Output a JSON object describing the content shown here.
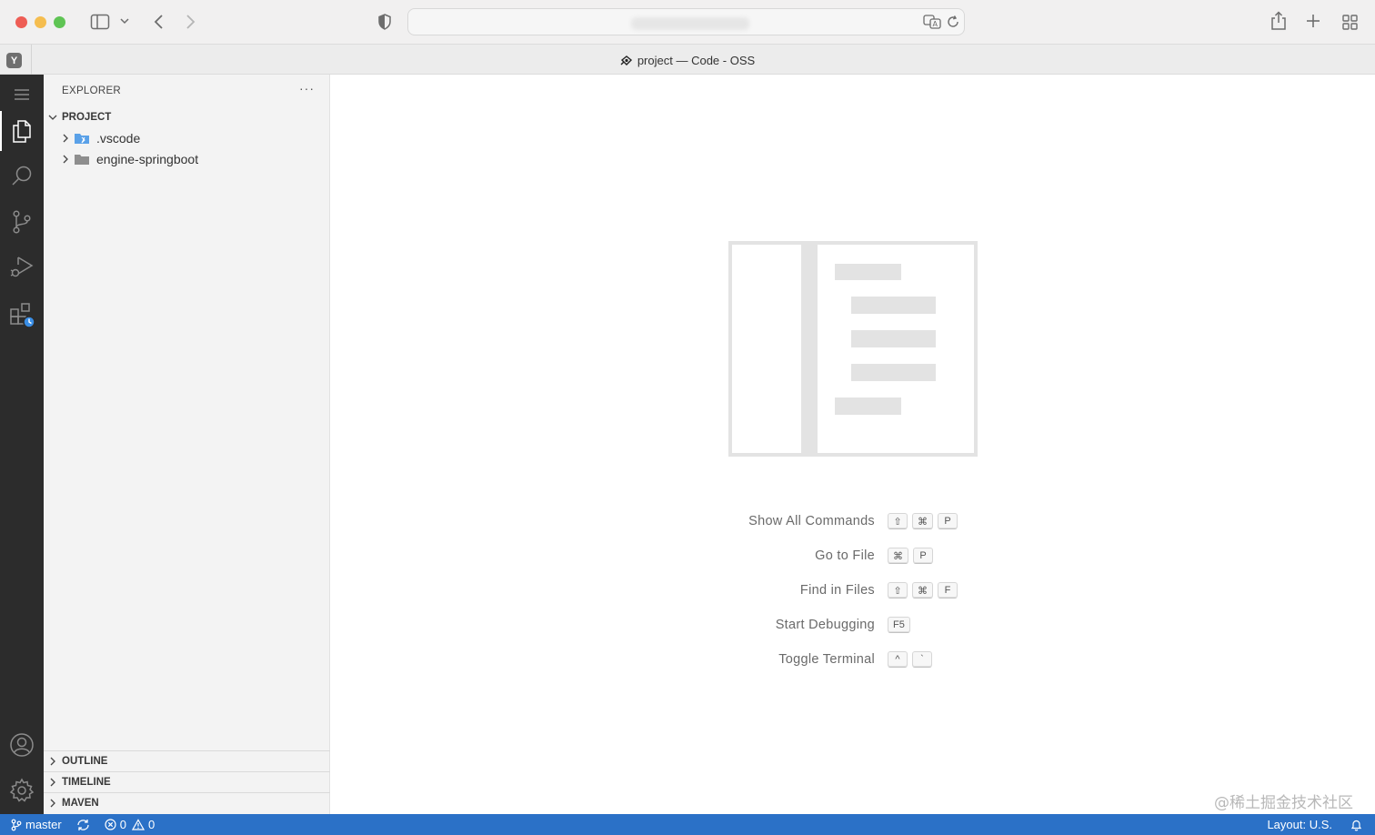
{
  "window": {
    "title": "project — Code - OSS",
    "tab_favicon": "Y"
  },
  "browser": {
    "icons": [
      "sidebar-toggle-icon",
      "chevron-down-icon",
      "back-icon",
      "forward-icon",
      "shield-icon",
      "translate-icon",
      "reload-icon",
      "share-icon",
      "new-tab-icon",
      "tab-overview-icon"
    ]
  },
  "activity_bar": {
    "items": [
      "menu-icon",
      "files-icon",
      "search-icon",
      "source-control-icon",
      "run-debug-icon",
      "extensions-icon",
      "account-icon",
      "settings-icon"
    ]
  },
  "sidebar": {
    "header": "EXPLORER",
    "more": "···",
    "project_label": "PROJECT",
    "tree": [
      {
        "name": ".vscode"
      },
      {
        "name": "engine-springboot"
      }
    ],
    "bottom_sections": [
      "OUTLINE",
      "TIMELINE",
      "MAVEN"
    ]
  },
  "editor": {
    "shortcuts": [
      {
        "label": "Show All Commands",
        "keys": [
          "⇧",
          "⌘",
          "P"
        ]
      },
      {
        "label": "Go to File",
        "keys": [
          "⌘",
          "P"
        ]
      },
      {
        "label": "Find in Files",
        "keys": [
          "⇧",
          "⌘",
          "F"
        ]
      },
      {
        "label": "Start Debugging",
        "keys": [
          "F5"
        ]
      },
      {
        "label": "Toggle Terminal",
        "keys": [
          "^",
          "`"
        ]
      }
    ],
    "watermark_text": "@稀土掘金技术社区"
  },
  "status_bar": {
    "branch": "master",
    "errors": "0",
    "warnings": "0",
    "layout": "Layout: U.S.",
    "color": "#2b71c7"
  }
}
